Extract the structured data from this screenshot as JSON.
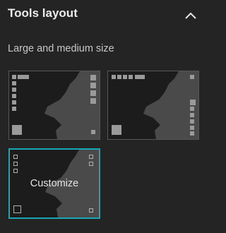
{
  "panel": {
    "title": "Tools layout",
    "collapse_icon": "chevron-up-icon",
    "section_label": "Large and medium size",
    "options": [
      {
        "id": "layout-left",
        "selected": false
      },
      {
        "id": "layout-right",
        "selected": false
      },
      {
        "id": "layout-customize",
        "label": "Customize",
        "selected": true
      }
    ]
  },
  "colors": {
    "background": "#242424",
    "map_dark": "#1c1c1c",
    "map_land": "#4a4a4a",
    "tool_block": "#9a9a9a",
    "selected_border": "#17a8b8"
  }
}
